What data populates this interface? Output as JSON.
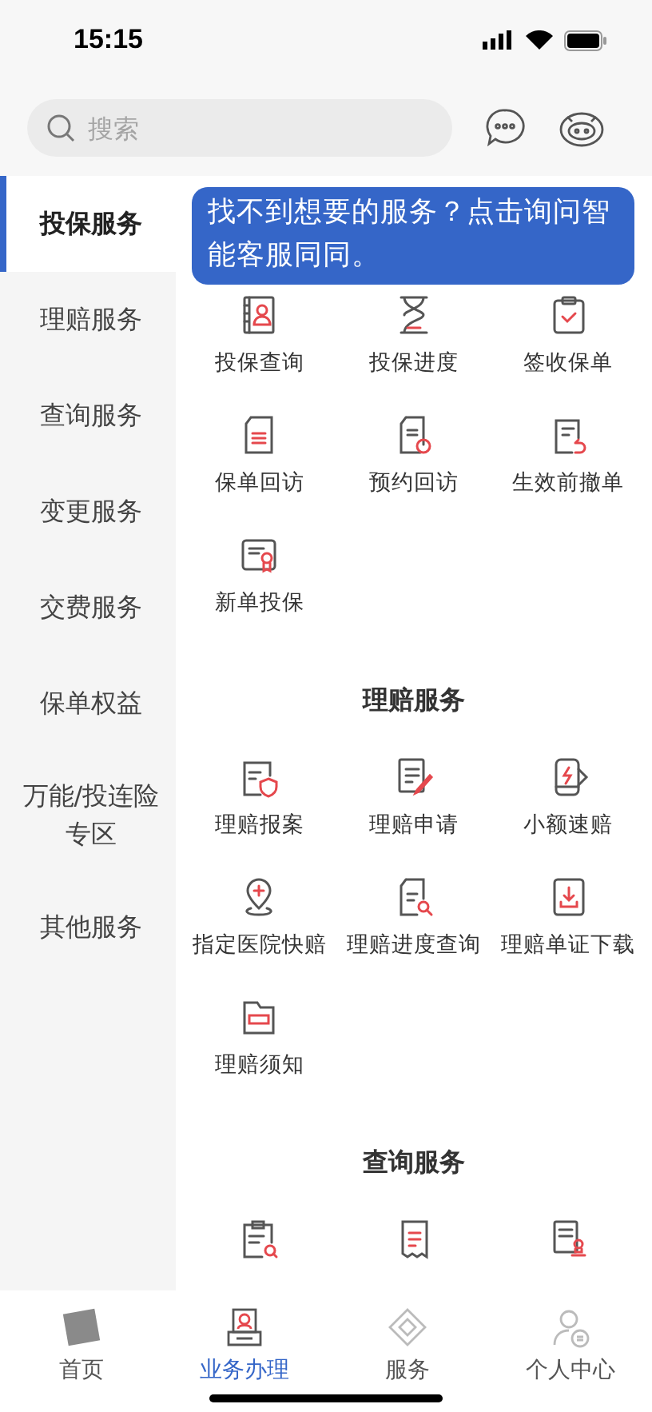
{
  "status_bar": {
    "time": "15:15"
  },
  "search": {
    "placeholder": "搜索"
  },
  "sidebar": {
    "items": [
      {
        "label": "投保服务",
        "selected": true
      },
      {
        "label": "理赔服务",
        "selected": false
      },
      {
        "label": "查询服务",
        "selected": false
      },
      {
        "label": "变更服务",
        "selected": false
      },
      {
        "label": "交费服务",
        "selected": false
      },
      {
        "label": "保单权益",
        "selected": false
      },
      {
        "label": "万能/投连险专区",
        "selected": false
      },
      {
        "label": "其他服务",
        "selected": false
      }
    ]
  },
  "tip": {
    "text": "找不到想要的服务？点击询问智能客服同同。"
  },
  "sections": [
    {
      "items": [
        "投保查询",
        "投保进度",
        "签收保单",
        "保单回访",
        "预约回访",
        "生效前撤单",
        "新单投保"
      ]
    },
    {
      "title": "理赔服务",
      "items": [
        "理赔报案",
        "理赔申请",
        "小额速赔",
        "指定医院快赔",
        "理赔进度查询",
        "理赔单证下载",
        "理赔须知"
      ]
    },
    {
      "title": "查询服务",
      "items": [
        {
          "kind": "icon_only"
        },
        {
          "kind": "icon_only"
        },
        {
          "kind": "icon_only"
        }
      ]
    }
  ],
  "tab_bar": [
    {
      "label": "首页",
      "selected": false
    },
    {
      "label": "业务办理",
      "selected": true
    },
    {
      "label": "服务",
      "selected": false
    },
    {
      "label": "个人中心",
      "selected": false
    }
  ]
}
